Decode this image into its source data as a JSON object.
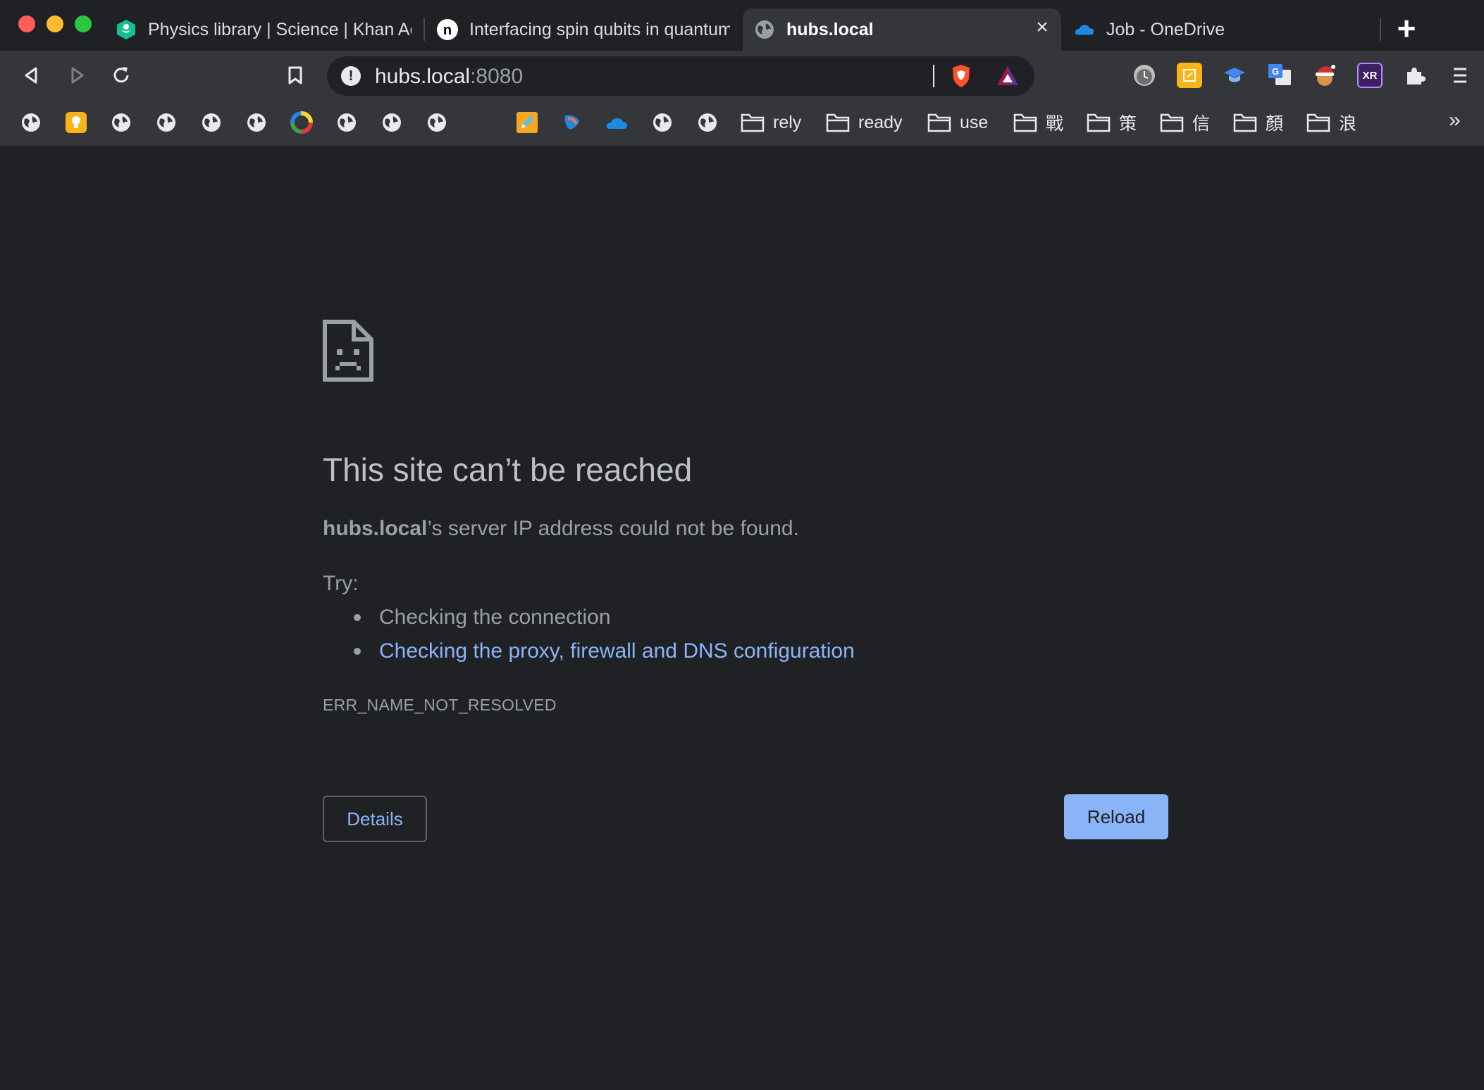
{
  "window": {
    "traffic_lights": [
      "close",
      "minimize",
      "maximize"
    ]
  },
  "tabs": [
    {
      "title": "Physics library | Science | Khan Academy",
      "favicon": "khan-academy-icon",
      "active": false
    },
    {
      "title": "Interfacing spin qubits in quantum dots",
      "favicon": "n-logo-icon",
      "active": false
    },
    {
      "title": "hubs.local",
      "favicon": "globe-icon",
      "active": true,
      "close": "×"
    },
    {
      "title": "Job - OneDrive",
      "favicon": "onedrive-icon",
      "active": false
    }
  ],
  "new_tab_label": "+",
  "toolbar": {
    "url_host": "hubs.local",
    "url_port": ":8080",
    "info_icon": "!",
    "extensions": [
      "clock-icon",
      "note-icon",
      "graduation-cap-icon",
      "translate-icon",
      "cookie-santa-icon",
      "xr-icon",
      "puzzle-icon",
      "menu-icon"
    ],
    "xr_label": "XR"
  },
  "bookmarks": {
    "icon_items": [
      "globe-icon",
      "bulb-icon",
      "globe-icon",
      "globe-icon",
      "globe-icon",
      "globe-icon",
      "color-wheel-icon",
      "globe-icon",
      "globe-icon",
      "globe-icon",
      "pencil-icon",
      "feather-icon",
      "onedrive-icon",
      "globe-icon",
      "globe-icon"
    ],
    "folders": [
      "rely",
      "ready",
      "use",
      "戰",
      "策",
      "信",
      "顏",
      "浪"
    ],
    "more": "»"
  },
  "error": {
    "heading": "This site can’t be reached",
    "host": "hubs.local",
    "summary_rest": "’s server IP address could not be found.",
    "try_label": "Try:",
    "suggestions": [
      "Checking the connection",
      "Checking the proxy, firewall and DNS configuration"
    ],
    "code": "ERR_NAME_NOT_RESOLVED",
    "details_button": "Details",
    "reload_button": "Reload"
  },
  "colors": {
    "background": "#202124",
    "toolbar": "#35363a",
    "link": "#8ab4f8",
    "reload_button": "#8ab4f8"
  }
}
